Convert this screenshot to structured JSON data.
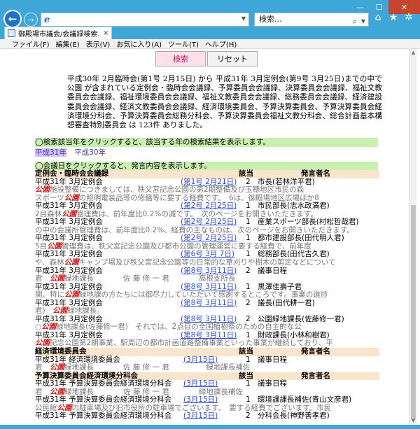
{
  "browser": {
    "search_placeholder": "検索...",
    "tab_title": "御殿場市議会/会議録検索...",
    "tab_close": "×",
    "window_min": "—",
    "window_max": "☐",
    "window_close": "✕",
    "icons": [
      "back-icon",
      "forward-icon",
      "ie-logo-icon",
      "search-icon",
      "home-icon",
      "favorites-icon",
      "settings-icon"
    ]
  },
  "menu": [
    "ファイル(F)",
    "編集(E)",
    "表示(V)",
    "お気に入り(A)",
    "ツール(T)",
    "ヘルプ(H)"
  ],
  "buttons": {
    "search": "検索",
    "reset": "リセット"
  },
  "summary": "平成30年 2月臨時会(第1号 2月15日) から 平成31年 3月定例会(第9号 3月25日)までの中で 公園 が含まれている定例会・臨時会会議録、予算委員会会議録、決算委員会会議録、福祉文教委員会会議録、福祉環境委員会会議録、福祉文教委員会会議録、総務委員会会議録、経済建設委員会会議録、経済文教委員会会議録、経済環境委員会、予算決算委員会、予算決算委員会経済環境分科会、予算決算委員会総務分科会、予算決算委員会福祉文教分科会、総合計画基本構想審査特別委員会 は 123件 ありました。",
  "year_hint": "◯検索該当年をクリックすると、該当する年の検索結果を表示します。",
  "years": [
    "平成31年",
    "平成30年"
  ],
  "date_hint": "◯会議日をクリックすると、発言内容を表示します。",
  "results": [
    {
      "kind": "section",
      "name": "定例会・臨時会会議録",
      "page": "該当",
      "speaker": "発言者名"
    },
    {
      "kind": "row",
      "name": "平成31年 3月定例会",
      "date": "(第1号 2月21日)",
      "page": "2",
      "speaker": "市長(若林洋平君)"
    },
    {
      "kind": "snip",
      "before": "   ",
      "hit": "公園",
      "after": "施設整備につきましては、秩父宮記念公園の第2期整備及び玉穂地区市民の森"
    },
    {
      "kind": "snip",
      "before": "  スポーツ",
      "hit": "公園",
      "after": "の照明電装品等の修繕等に要する経費です。　6は、御殿場地区広場ほか8"
    },
    {
      "kind": "row",
      "name": "平成31年 3月定例会",
      "date": "(第2号 2月25日)",
      "page": "1",
      "speaker": "市民部長(志水政満君)"
    },
    {
      "kind": "snip",
      "before": "  2目森林",
      "hit": "公園",
      "after": "管理費は、前年度比0.2%の減です。　次のページをお開きいただきます。"
    },
    {
      "kind": "row",
      "name": "平成31年 3月定例会",
      "date": "(第2号 2月25日)",
      "page": "1",
      "speaker": "産業スポーツ部長(村松哲哉君)"
    },
    {
      "kind": "snip",
      "before": "  ",
      "hit": "",
      "after": "の中の会議所管理費は、前年度比0.2%、経費の主なものは、次のページをお開きいただきます。"
    },
    {
      "kind": "row",
      "name": "平成31年 3月定例会",
      "date": "(第2号 2月25日)",
      "page": "1",
      "speaker": "都市建設部長(田代明人君)"
    },
    {
      "kind": "snip",
      "before": "    5目",
      "hit": "公園",
      "after": "管理費は、秩父宮記念公園及び都市公園の管理運営に要する経費で、前年度"
    },
    {
      "kind": "row",
      "name": "平成31年 3月定例会",
      "date": "(第6号 3月 7日)",
      "page": "1",
      "speaker": "総務部長(田代吉久君)"
    },
    {
      "kind": "snip",
      "before": "  や、森林",
      "hit": "公園",
      "after": "キャンプ場及び秩父宮記念公園等の日常的な草刈りや樹木の剪定などについて"
    },
    {
      "kind": "row",
      "name": "平成31年 3月定例会",
      "date": "(第8号 3月11日)",
      "page": "2",
      "speaker": "議事日程"
    },
    {
      "kind": "snip",
      "before": "      君　",
      "hit": "公園",
      "after": "緑地課長　　　　佐 藤 修 一 君　　　　高根支所長"
    },
    {
      "kind": "row",
      "name": "平成31年 3月定例会",
      "date": "(第8号 3月11日)",
      "page": "1",
      "speaker": "黒澤佳壽子君"
    },
    {
      "kind": "snip",
      "before": "    関、特に",
      "hit": "公園",
      "after": "緑地課の方たちには御尽力していただいて感謝するところです。事業の進捗"
    },
    {
      "kind": "row",
      "name": "平成31年 3月定例会",
      "date": "(第8号 3月11日)",
      "page": "2",
      "speaker": "議長(田代耕一君)"
    },
    {
      "kind": "snip",
      "before": "    君)　",
      "hit": "公園",
      "after": "緑地課長。"
    },
    {
      "kind": "row",
      "name": "平成31年 3月定例会",
      "date": "(第8号 3月11日)",
      "page": "2",
      "speaker": "公園緑地課長(佐藤修一君)"
    },
    {
      "kind": "snip",
      "before": "  ○",
      "hit": "公園",
      "after": "緑地課長(佐藤修一君)　それでは、2点目の全国植樹祭のための自主的な公"
    },
    {
      "kind": "row",
      "name": "平成31年 3月定例会",
      "date": "(第8号 3月11日)",
      "page": "1",
      "speaker": "財政課長(小林和樹君)"
    },
    {
      "kind": "snip",
      "before": "  ",
      "hit": "公園",
      "after": "記念公園第2期事業、駅周辺の都市計画道路整備事業といった事業が継続しており、平"
    },
    {
      "kind": "section",
      "name": "経済環境委員会",
      "page": "該当",
      "speaker": "発言者名"
    },
    {
      "kind": "row",
      "name": "平成31年 経済環境委員会",
      "date": "(3月15日)",
      "short": true,
      "page": "1",
      "speaker": "議事日程"
    },
    {
      "kind": "snip",
      "before": "      君　",
      "hit": "公園",
      "after": "緑地課長　　　　佐 藤 修 一 君　　　　　緑地課長補佐"
    },
    {
      "kind": "section",
      "name": "予算決算委員会経済環境分科会",
      "page": "該当",
      "speaker": "発言者名"
    },
    {
      "kind": "row",
      "name": "平成31年 予算決算委員会経済環境分科会",
      "date": "(3月15日)",
      "short": true,
      "page": "1",
      "speaker": "議事日程"
    },
    {
      "kind": "snip",
      "before": "      君　",
      "hit": "公園",
      "after": "緑地課長　　　　佐 藤 修 一 君　　　　緑地課長補佐"
    },
    {
      "kind": "row",
      "name": "平成31年 予算決算委員会経済環境分科会",
      "date": "(3月15日)",
      "short": true,
      "page": "1",
      "speaker": "環境課課長補佐(青山文彦君)"
    },
    {
      "kind": "snip",
      "before": "  公民館",
      "hit": "公園",
      "after": "の駐車場及び旧市役所の駐車場でございます。　要する経費でございます。市民"
    },
    {
      "kind": "row",
      "name": "平成31年 予算決算委員会経済環境分科会",
      "date": "(3月15日)",
      "short": true,
      "page": "2",
      "speaker": "分科会長(神野善孝君)"
    }
  ]
}
